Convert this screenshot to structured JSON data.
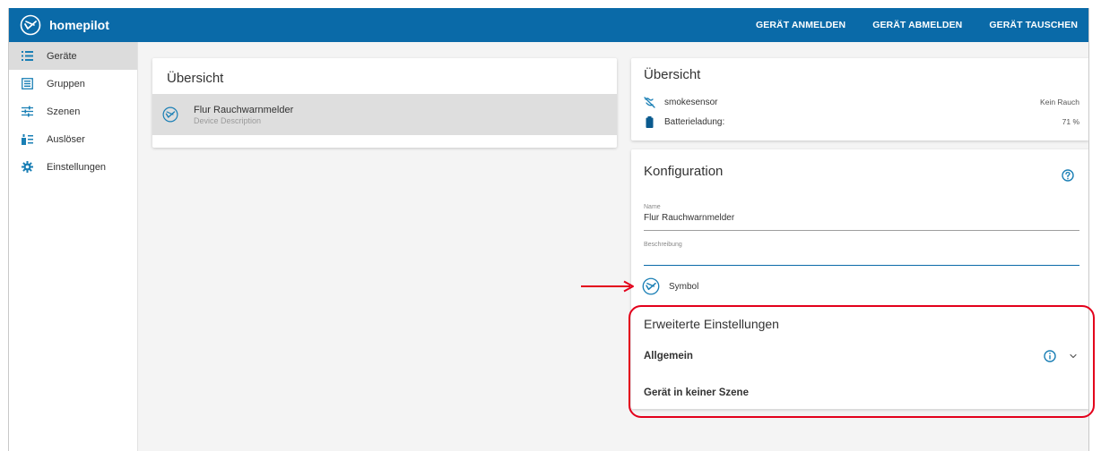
{
  "topbar": {
    "brand": "homepilot",
    "actions": [
      "GERÄT ANMELDEN",
      "GERÄT ABMELDEN",
      "GERÄT TAUSCHEN"
    ]
  },
  "sidebar": {
    "items": [
      {
        "label": "Geräte",
        "icon": "list-icon",
        "active": true
      },
      {
        "label": "Gruppen",
        "icon": "group-icon",
        "active": false
      },
      {
        "label": "Szenen",
        "icon": "scenes-icon",
        "active": false
      },
      {
        "label": "Auslöser",
        "icon": "trigger-icon",
        "active": false
      },
      {
        "label": "Einstellungen",
        "icon": "settings-icon",
        "active": false
      }
    ]
  },
  "left_overview": {
    "title": "Übersicht",
    "device": {
      "name": "Flur Rauchwarnmelder",
      "description": "Device Description"
    }
  },
  "right_overview": {
    "title": "Übersicht",
    "rows": [
      {
        "label": "smokesensor",
        "value": "Kein Rauch",
        "icon": "smoke-sensor-icon"
      },
      {
        "label": "Batterieladung:",
        "value": "71 %",
        "icon": "battery-icon"
      }
    ]
  },
  "konfiguration": {
    "title": "Konfiguration",
    "name_label": "Name",
    "name_value": "Flur Rauchwarnmelder",
    "beschreibung_label": "Beschreibung",
    "beschreibung_value": "",
    "symbol_label": "Symbol",
    "erweitert_title": "Erweiterte Einstellungen",
    "allgemein_label": "Allgemein",
    "szene_label": "Gerät in keiner Szene"
  },
  "colors": {
    "brand": "#0a6aa8",
    "highlight": "#e3001b",
    "icon": "#1a7fb5"
  }
}
